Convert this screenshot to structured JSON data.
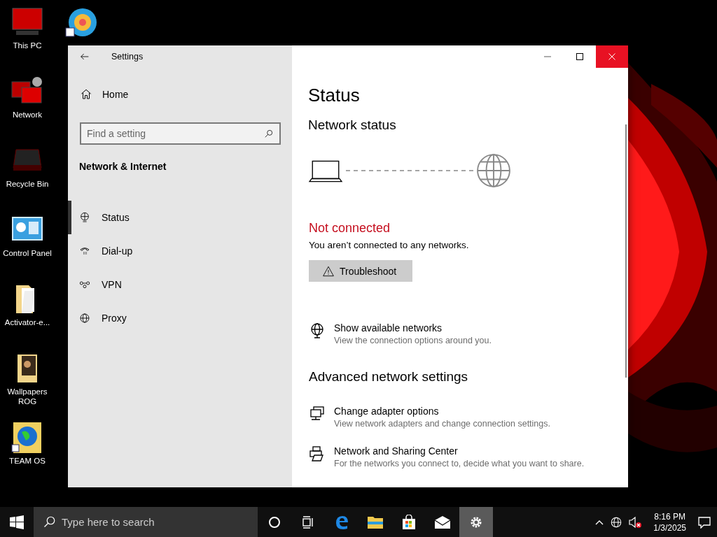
{
  "desktop_icons": [
    {
      "kind": "monitor",
      "label": "This PC"
    },
    {
      "kind": "network",
      "label": "Network"
    },
    {
      "kind": "bin",
      "label": "Recycle Bin"
    },
    {
      "kind": "panel",
      "label": "Control Panel"
    },
    {
      "kind": "folder",
      "label": "Activator-e..."
    },
    {
      "kind": "photo-folder",
      "label": "Wallpapers ROG"
    },
    {
      "kind": "globe",
      "label": "TEAM OS"
    }
  ],
  "window": {
    "title": "Settings",
    "sidebar": {
      "home": "Home",
      "search": {
        "placeholder": "Find a setting"
      },
      "section": "Network & Internet",
      "items": [
        {
          "kind": "status",
          "label": "Status",
          "selected": true
        },
        {
          "kind": "dialup",
          "label": "Dial-up",
          "selected": false
        },
        {
          "kind": "vpn",
          "label": "VPN",
          "selected": false
        },
        {
          "kind": "proxy",
          "label": "Proxy",
          "selected": false
        }
      ]
    },
    "content": {
      "heading": "Status",
      "subheading": "Network status",
      "connection": {
        "connected": false,
        "state": "Not connected",
        "message": "You aren’t connected to any networks."
      },
      "troubleshoot_button": "Troubleshoot",
      "links": [
        {
          "kind": "available",
          "title": "Show available networks",
          "subtitle": "View the connection options around you."
        }
      ],
      "advanced_heading": "Advanced network settings",
      "advanced_links": [
        {
          "kind": "adapter",
          "title": "Change adapter options",
          "subtitle": "View network adapters and change connection settings."
        },
        {
          "kind": "sharing",
          "title": "Network and Sharing Center",
          "subtitle": "For the networks you connect to, decide what you want to share."
        }
      ]
    }
  },
  "taskbar": {
    "search": {
      "placeholder": "Type here to search"
    },
    "apps": [
      {
        "kind": "cortana",
        "active": false
      },
      {
        "kind": "taskview",
        "active": false
      },
      {
        "kind": "edge",
        "active": false
      },
      {
        "kind": "explorer",
        "active": false
      },
      {
        "kind": "store",
        "active": false
      },
      {
        "kind": "mail",
        "active": false
      },
      {
        "kind": "settings",
        "active": true
      }
    ],
    "time": "8:16 PM",
    "date": "1/3/2025"
  }
}
